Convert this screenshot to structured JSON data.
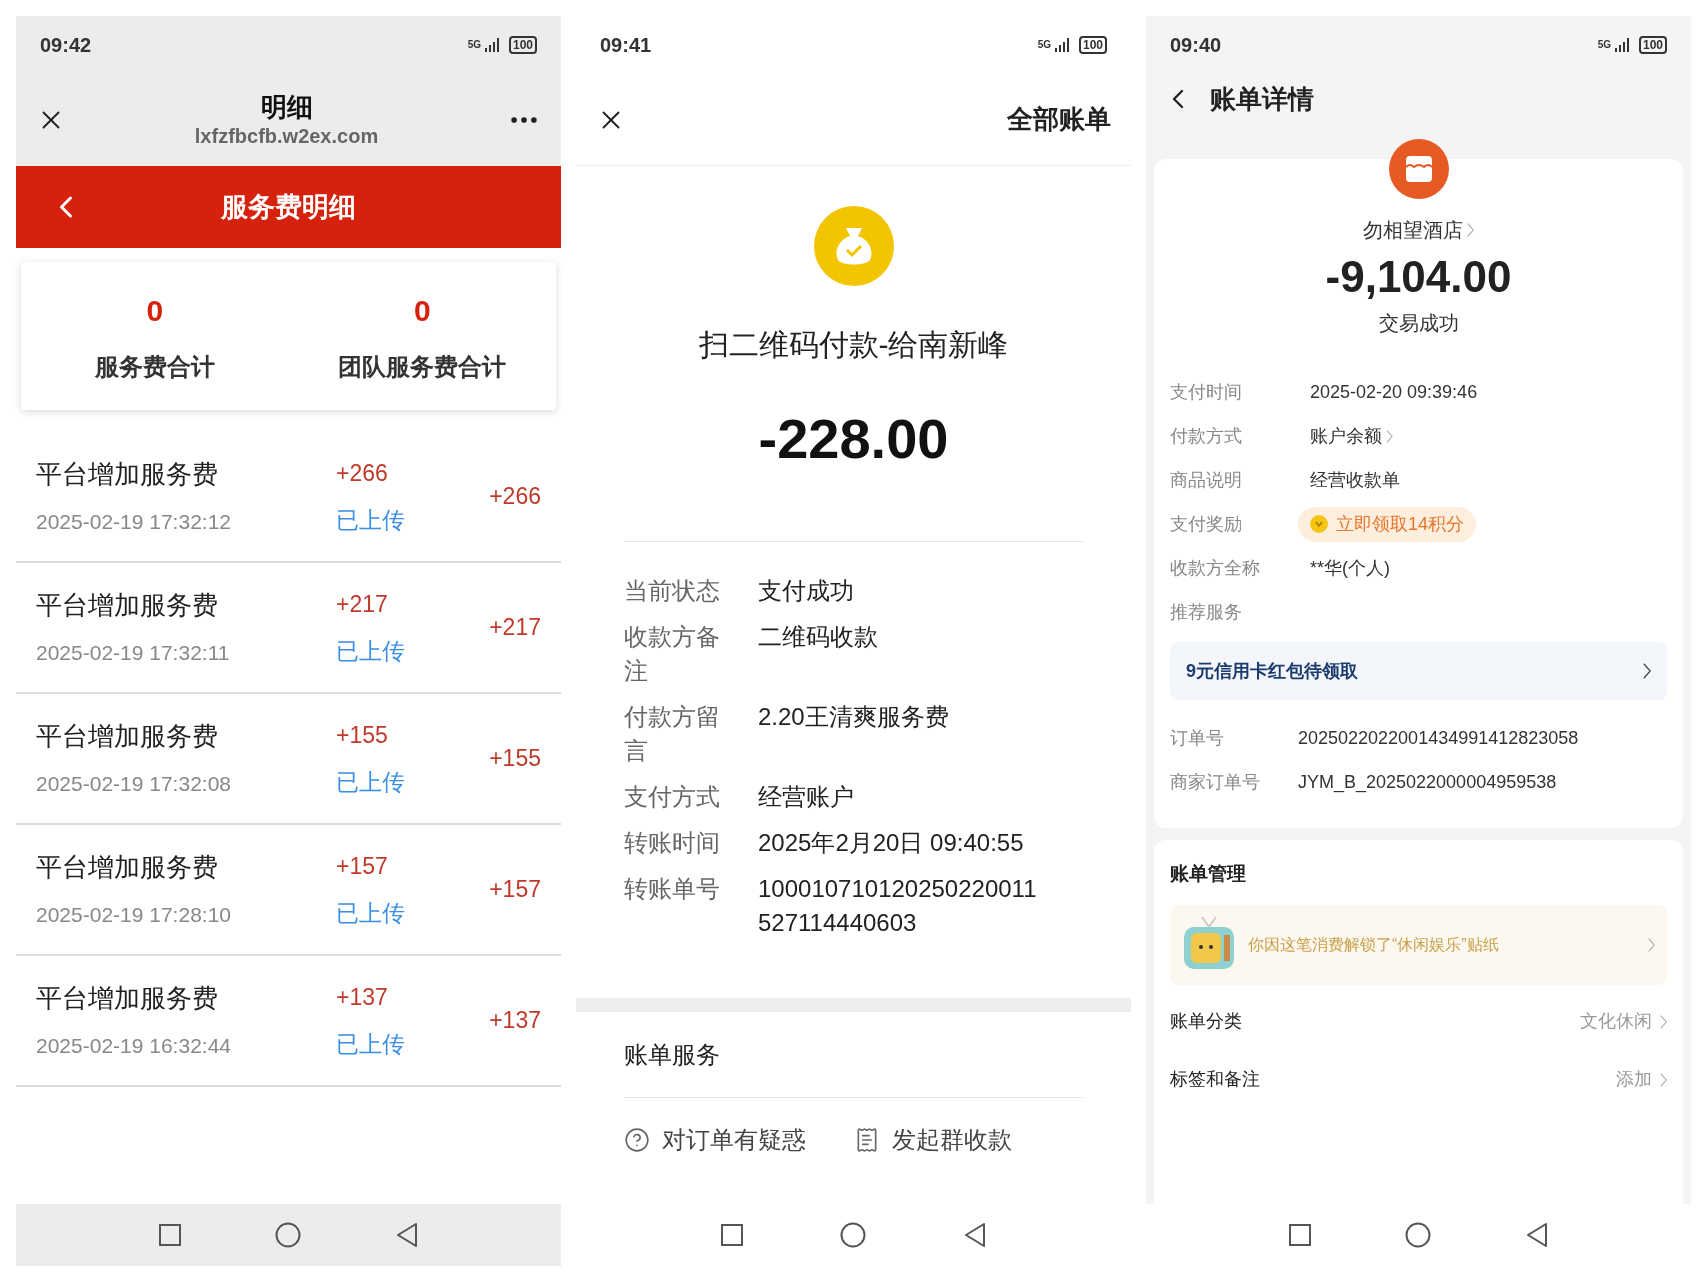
{
  "fee_detail_screen": {
    "status_bar": {
      "time": "09:42",
      "network": "5G",
      "battery": "100"
    },
    "browser_bar": {
      "title": "明细",
      "url": "lxfzfbcfb.w2ex.com"
    },
    "header": {
      "title": "服务费明细"
    },
    "summary": [
      {
        "value": "0",
        "label": "服务费合计"
      },
      {
        "value": "0",
        "label": "团队服务费合计"
      }
    ],
    "records": [
      {
        "title": "平台增加服务费",
        "time": "2025-02-19 17:32:12",
        "amount": "+266",
        "status": "已上传",
        "total": "+266"
      },
      {
        "title": "平台增加服务费",
        "time": "2025-02-19 17:32:11",
        "amount": "+217",
        "status": "已上传",
        "total": "+217"
      },
      {
        "title": "平台增加服务费",
        "time": "2025-02-19 17:32:08",
        "amount": "+155",
        "status": "已上传",
        "total": "+155"
      },
      {
        "title": "平台增加服务费",
        "time": "2025-02-19 17:28:10",
        "amount": "+157",
        "status": "已上传",
        "total": "+157"
      },
      {
        "title": "平台增加服务费",
        "time": "2025-02-19 16:32:44",
        "amount": "+137",
        "status": "已上传",
        "total": "+137"
      }
    ]
  },
  "transfer_screen": {
    "status_bar": {
      "time": "09:41",
      "network": "5G",
      "battery": "100"
    },
    "top_bar": {
      "action": "全部账单"
    },
    "title": "扫二维码付款-给南新峰",
    "amount": "-228.00",
    "details": [
      {
        "label": "当前状态",
        "value": "支付成功"
      },
      {
        "label": "收款方备注",
        "value": "二维码收款"
      },
      {
        "label": "付款方留言",
        "value": "2.20王清爽服务费"
      },
      {
        "label": "支付方式",
        "value": "经营账户"
      },
      {
        "label": "转账时间",
        "value": "2025年2月20日 09:40:55"
      },
      {
        "label": "转账单号",
        "value": "100010710120250220011527114440603"
      }
    ],
    "service_title": "账单服务",
    "actions": [
      {
        "kind": "question",
        "label": "对订单有疑惑"
      },
      {
        "kind": "receipt",
        "label": "发起群收款"
      }
    ]
  },
  "bill_detail_screen": {
    "status_bar": {
      "time": "09:40",
      "network": "5G",
      "battery": "100"
    },
    "title": "账单详情",
    "merchant": "勿相望酒店",
    "amount": "-9,104.00",
    "status": "交易成功",
    "details": [
      {
        "kind": "text",
        "label": "支付时间",
        "value": "2025-02-20 09:39:46"
      },
      {
        "kind": "link",
        "label": "付款方式",
        "value": "账户余额"
      },
      {
        "kind": "text",
        "label": "商品说明",
        "value": "经营收款单"
      },
      {
        "kind": "reward",
        "label": "支付奖励",
        "value": "立即领取14积分"
      },
      {
        "kind": "text",
        "label": "收款方全称",
        "value": "**华(个人)"
      },
      {
        "kind": "text",
        "label": "推荐服务"
      }
    ],
    "promo": "9元信用卡红包待领取",
    "order_rows": [
      {
        "label": "订单号",
        "value": "2025022022001434991412823058"
      },
      {
        "label": "商家订单号",
        "value": "JYM_B_2025022000004959538"
      }
    ],
    "management": {
      "title": "账单管理",
      "sticker_text": "你因这笔消费解锁了“休闲娱乐”贴纸",
      "rows": [
        {
          "label": "账单分类",
          "value": "文化休闲"
        },
        {
          "label": "标签和备注",
          "value": "添加"
        }
      ]
    }
  }
}
